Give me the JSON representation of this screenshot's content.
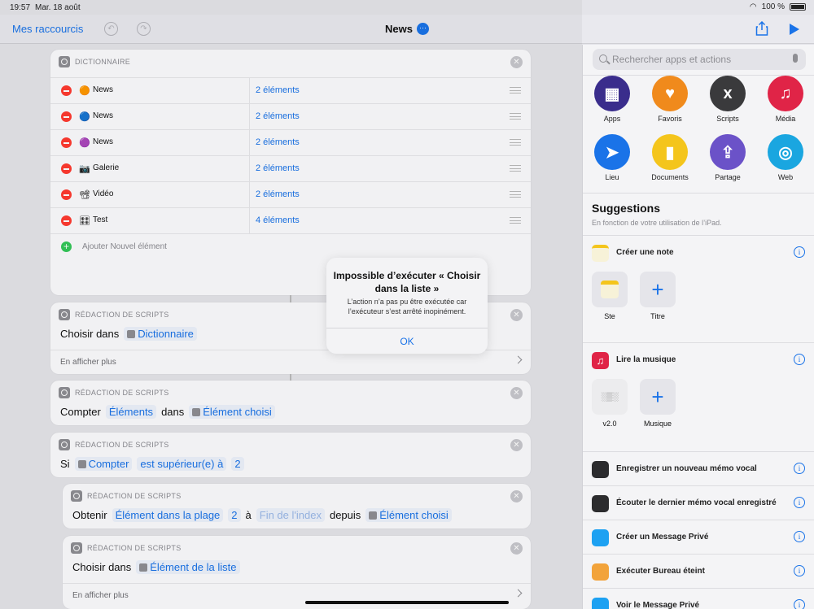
{
  "status": {
    "time": "19:57",
    "date": "Mar. 18 août",
    "battery": "100 %"
  },
  "nav": {
    "back": "Mes raccourcis",
    "title": "News",
    "more": "···"
  },
  "dictionary": {
    "header": "DICTIONNAIRE",
    "rows": [
      {
        "emoji": "🟠",
        "key": "News",
        "value": "2 éléments"
      },
      {
        "emoji": "🔵",
        "key": "News",
        "value": "2 éléments"
      },
      {
        "emoji": "🟣",
        "key": "News",
        "value": "2 éléments"
      },
      {
        "emoji": "📷",
        "key": "Galerie",
        "value": "2 éléments"
      },
      {
        "emoji": "📽",
        "key": "Vidéo",
        "value": "2 éléments"
      },
      {
        "emoji": "🎛",
        "key": "Test",
        "value": "4 éléments"
      }
    ],
    "add_label": "Ajouter Nouvel élément"
  },
  "actions": [
    {
      "header": "RÉDACTION DE SCRIPTS",
      "w1": "Choisir dans",
      "t1": "Dictionnaire",
      "more": "En afficher plus"
    },
    {
      "header": "RÉDACTION DE SCRIPTS",
      "w1": "Compter",
      "t1": "Éléments",
      "w2": "dans",
      "t2": "Élément choisi"
    },
    {
      "header": "RÉDACTION DE SCRIPTS",
      "w1": "Si",
      "t1": "Compter",
      "t2": "est supérieur(e) à",
      "t3": "2"
    },
    {
      "header": "RÉDACTION DE SCRIPTS",
      "w1": "Obtenir",
      "t1": "Élément dans la plage",
      "t2": "2",
      "w2": "à",
      "t3": "Fin de l'index",
      "w3": "depuis",
      "t4": "Élément choisi"
    },
    {
      "header": "RÉDACTION DE SCRIPTS",
      "w1": "Choisir dans",
      "t1": "Élément de la liste",
      "more": "En afficher plus"
    }
  ],
  "alert": {
    "title": "Impossible d’exécuter « Choisir dans la liste »",
    "message": "L’action n’a pas pu être exécutée car l’exécuteur s’est arrêté inopinément.",
    "ok": "OK"
  },
  "sidebar": {
    "search_placeholder": "Rechercher apps et actions",
    "categories": [
      {
        "label": "Apps",
        "color": "#3a2d8c",
        "glyph": "▦"
      },
      {
        "label": "Favoris",
        "color": "#f08a1c",
        "glyph": "♥"
      },
      {
        "label": "Scripts",
        "color": "#3a3a3c",
        "glyph": "x"
      },
      {
        "label": "Média",
        "color": "#e02447",
        "glyph": "♫"
      },
      {
        "label": "Lieu",
        "color": "#1a73e8",
        "glyph": "➤"
      },
      {
        "label": "Documents",
        "color": "#f4c51c",
        "glyph": "▮"
      },
      {
        "label": "Partage",
        "color": "#6b52c8",
        "glyph": "⇪"
      },
      {
        "label": "Web",
        "color": "#1aa6e0",
        "glyph": "◎"
      }
    ],
    "suggestions_title": "Suggestions",
    "suggestions_sub": "En fonction de votre utilisation de l’iPad.",
    "note_label": "Créer une note",
    "note_tiles": [
      "Ste",
      "Titre"
    ],
    "music_label": "Lire la musique",
    "music_tiles": [
      "v2.0",
      "Musique"
    ],
    "rows": [
      {
        "label": "Enregistrer un nouveau mémo vocal",
        "color": "#2c2c2e"
      },
      {
        "label": "Écouter le dernier mémo vocal enregistré",
        "color": "#2c2c2e"
      },
      {
        "label": "Créer un Message Privé",
        "color": "#1da1f2"
      },
      {
        "label": "Exécuter Bureau éteint",
        "color": "#f2a33a"
      },
      {
        "label": "Voir le Message Privé",
        "color": "#1da1f2"
      }
    ]
  }
}
